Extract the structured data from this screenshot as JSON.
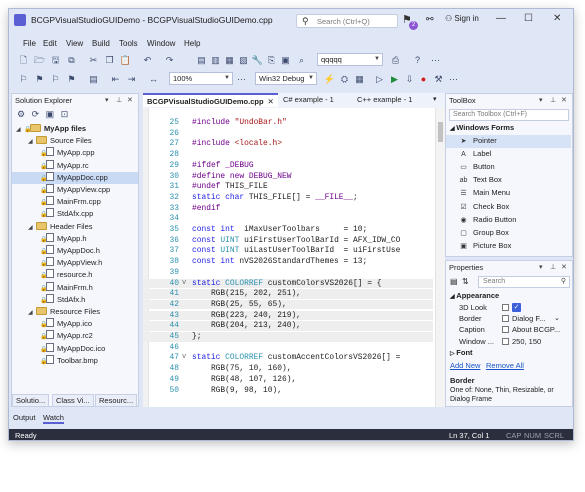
{
  "window": {
    "title": "BCGPVisualStudioGUIDemo - BCGPVisualStudioGUIDemo.cpp",
    "search_placeholder": "Search (Ctrl+Q)",
    "notif_count": "2",
    "sign_in": "Sign in",
    "min_glyph": "—",
    "max_glyph": "☐",
    "close_glyph": "✕"
  },
  "menu": [
    "File",
    "Edit",
    "View",
    "Build",
    "Tools",
    "Window",
    "Help"
  ],
  "toolbar": {
    "find_combo": "qqqqq",
    "zoom_combo": "100%",
    "config_combo": "Win32 Debug"
  },
  "solution_explorer": {
    "title": "Solution Explorer",
    "project": "MyApp files",
    "source_files": "Source Files",
    "source_items": [
      "MyApp.cpp",
      "MyApp.rc",
      "MyAppDoc.cpp",
      "MyAppView.cpp",
      "MainFrm.cpp",
      "StdAfx.cpp"
    ],
    "header_files": "Header Files",
    "header_items": [
      "MyApp.h",
      "MyAppDoc.h",
      "MyAppView.h",
      "resource.h",
      "MainFrm.h",
      "StdAfx.h"
    ],
    "resource_files": "Resource Files",
    "resource_items": [
      "MyApp.ico",
      "MyApp.rc2",
      "MyAppDoc.ico",
      "Toolbar.bmp"
    ],
    "tabs": [
      "Solutio...",
      "Class Vi...",
      "Resourc..."
    ]
  },
  "editor": {
    "tabs": [
      "BCGPVisualStudioGUIDemo.cpp",
      "C# example - 1",
      "C++ example - 1"
    ],
    "lines": [
      {
        "n": "25",
        "fold": "",
        "hl": false,
        "segs": [
          [
            "pp",
            "#include "
          ],
          [
            "str",
            "\"UndoBar.h\""
          ]
        ]
      },
      {
        "n": "26",
        "fold": "",
        "hl": false,
        "segs": []
      },
      {
        "n": "27",
        "fold": "",
        "hl": false,
        "segs": [
          [
            "pp",
            "#include "
          ],
          [
            "str",
            "<locale.h>"
          ]
        ]
      },
      {
        "n": "28",
        "fold": "",
        "hl": false,
        "segs": []
      },
      {
        "n": "29",
        "fold": "",
        "hl": false,
        "segs": [
          [
            "pp",
            "#ifdef "
          ],
          [
            "mac",
            "_DEBUG"
          ]
        ]
      },
      {
        "n": "30",
        "fold": "",
        "hl": false,
        "segs": [
          [
            "pp",
            "#define "
          ],
          [
            "mac",
            "new DEBUG_NEW"
          ]
        ]
      },
      {
        "n": "31",
        "fold": "",
        "hl": false,
        "segs": [
          [
            "pp",
            "#undef "
          ],
          [
            "txt",
            "THIS_FILE"
          ]
        ]
      },
      {
        "n": "32",
        "fold": "",
        "hl": false,
        "segs": [
          [
            "kw",
            "static char "
          ],
          [
            "txt",
            "THIS_FILE[] = "
          ],
          [
            "mac",
            "__FILE__"
          ],
          [
            "txt",
            ";"
          ]
        ]
      },
      {
        "n": "33",
        "fold": "",
        "hl": false,
        "segs": [
          [
            "pp",
            "#endif"
          ]
        ]
      },
      {
        "n": "34",
        "fold": "",
        "hl": false,
        "segs": []
      },
      {
        "n": "35",
        "fold": "",
        "hl": false,
        "segs": [
          [
            "kw",
            "const int "
          ],
          [
            "txt",
            " iMaxUserToolbars     = 10;"
          ]
        ]
      },
      {
        "n": "36",
        "fold": "",
        "hl": false,
        "segs": [
          [
            "kw",
            "const "
          ],
          [
            "typ",
            "UINT "
          ],
          [
            "txt",
            "uiFirstUserToolBarId = AFX_IDW_CO"
          ]
        ]
      },
      {
        "n": "37",
        "fold": "",
        "hl": false,
        "segs": [
          [
            "kw",
            "const "
          ],
          [
            "typ",
            "UINT "
          ],
          [
            "txt",
            "uiLastUserToolBarId  = uiFirstUse"
          ]
        ]
      },
      {
        "n": "38",
        "fold": "",
        "hl": false,
        "segs": [
          [
            "kw",
            "const int "
          ],
          [
            "txt",
            "nVS2026StandardThemes = 13;"
          ]
        ]
      },
      {
        "n": "39",
        "fold": "",
        "hl": false,
        "segs": []
      },
      {
        "n": "40",
        "fold": "v",
        "hl": true,
        "segs": [
          [
            "kw",
            "static "
          ],
          [
            "typ",
            "COLORREF "
          ],
          [
            "txt",
            "customColorsVS2026[] = {"
          ]
        ]
      },
      {
        "n": "41",
        "fold": "",
        "hl": true,
        "segs": [
          [
            "txt",
            "    RGB(215, 202, 251),"
          ]
        ]
      },
      {
        "n": "42",
        "fold": "",
        "hl": true,
        "segs": [
          [
            "txt",
            "    RGB(25, 55, 65),"
          ]
        ]
      },
      {
        "n": "43",
        "fold": "",
        "hl": true,
        "segs": [
          [
            "txt",
            "    RGB(223, 240, 219),"
          ]
        ]
      },
      {
        "n": "44",
        "fold": "",
        "hl": true,
        "segs": [
          [
            "txt",
            "    RGB(204, 213, 240),"
          ]
        ]
      },
      {
        "n": "45",
        "fold": "",
        "hl": true,
        "segs": [
          [
            "txt",
            "};"
          ]
        ]
      },
      {
        "n": "46",
        "fold": "",
        "hl": false,
        "segs": []
      },
      {
        "n": "47",
        "fold": "v",
        "hl": false,
        "segs": [
          [
            "kw",
            "static "
          ],
          [
            "typ",
            "COLORREF "
          ],
          [
            "txt",
            "customAccentColorsVS2026[] ="
          ]
        ]
      },
      {
        "n": "48",
        "fold": "",
        "hl": false,
        "segs": [
          [
            "txt",
            "    RGB(75, 10, 160),"
          ]
        ]
      },
      {
        "n": "49",
        "fold": "",
        "hl": false,
        "segs": [
          [
            "txt",
            "    RGB(48, 107, 126),"
          ]
        ]
      },
      {
        "n": "50",
        "fold": "",
        "hl": false,
        "segs": [
          [
            "txt",
            "    RGB(9, 98, 10),"
          ]
        ]
      }
    ]
  },
  "toolbox": {
    "title": "ToolBox",
    "search_placeholder": "Search Toolbox (Ctrl+F)",
    "group": "Windows Forms",
    "items": [
      {
        "label": "Pointer",
        "icon": "pointer-icon",
        "glyph": "➤"
      },
      {
        "label": "Label",
        "icon": "label-icon",
        "glyph": "A"
      },
      {
        "label": "Button",
        "icon": "button-icon",
        "glyph": "▭"
      },
      {
        "label": "Text Box",
        "icon": "textbox-icon",
        "glyph": "ab"
      },
      {
        "label": "Main Menu",
        "icon": "menu-icon",
        "glyph": "☰"
      },
      {
        "label": "Check Box",
        "icon": "checkbox-icon",
        "glyph": "☑"
      },
      {
        "label": "Radio Button",
        "icon": "radio-icon",
        "glyph": "◉"
      },
      {
        "label": "Group Box",
        "icon": "groupbox-icon",
        "glyph": "▢"
      },
      {
        "label": "Picture Box",
        "icon": "picture-icon",
        "glyph": "▣"
      }
    ]
  },
  "properties": {
    "title": "Properties",
    "search_placeholder": "Search",
    "category": "Appearance",
    "rows": [
      {
        "name": "3D Look",
        "value": ""
      },
      {
        "name": "Border",
        "value": "Dialog F..."
      },
      {
        "name": "Caption",
        "value": "About BCGP..."
      },
      {
        "name": "Window ...",
        "value": "250, 150"
      }
    ],
    "font_category": "Font",
    "links": [
      "Add New",
      "Remove All"
    ],
    "desc_title": "Border",
    "desc_text": "One of: None, Thin, Resizable, or Dialog Frame"
  },
  "output_tabs": [
    "Output",
    "Watch"
  ],
  "status": {
    "left": "Ready",
    "pos": "Ln  37, Col  1",
    "caps": "CAP",
    "num": "NUM",
    "scrl": "SCRL"
  }
}
